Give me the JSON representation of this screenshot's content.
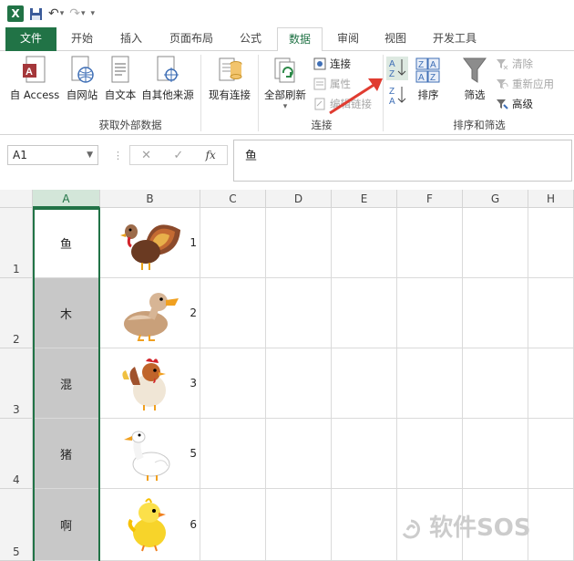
{
  "app": {
    "brand_color": "#217346",
    "logo_letter": "X"
  },
  "tabs": [
    "文件",
    "开始",
    "插入",
    "页面布局",
    "公式",
    "数据",
    "审阅",
    "视图",
    "开发工具"
  ],
  "active_tab": "数据",
  "ribbon": {
    "get_external": {
      "buttons": [
        "自 Access",
        "自网站",
        "自文本",
        "自其他来源",
        "现有连接"
      ],
      "group_label": "获取外部数据"
    },
    "connections": {
      "refresh_all": "全部刷新",
      "connections": "连接",
      "properties": "属性",
      "edit_links": "编辑链接",
      "group_label": "连接"
    },
    "sort_filter": {
      "sort": "排序",
      "filter": "筛选",
      "clear": "清除",
      "reapply": "重新应用",
      "advanced": "高级",
      "group_label": "排序和筛选"
    }
  },
  "formula_bar": {
    "name_box": "A1",
    "cancel": "✕",
    "confirm": "✓",
    "fx": "fx",
    "content": "鱼"
  },
  "columns": [
    "A",
    "B",
    "C",
    "D",
    "E",
    "F",
    "G",
    "H"
  ],
  "rows": [
    {
      "num": "1",
      "a": "鱼",
      "bird": "turkey-icon",
      "b": "1"
    },
    {
      "num": "2",
      "a": "木",
      "bird": "duck-icon",
      "b": "2"
    },
    {
      "num": "3",
      "a": "混",
      "bird": "rooster-icon",
      "b": "3"
    },
    {
      "num": "4",
      "a": "猪",
      "bird": "goose-icon",
      "b": "5"
    },
    {
      "num": "5",
      "a": "啊",
      "bird": "chick-icon",
      "b": "6"
    }
  ],
  "watermark": "软件SOS"
}
